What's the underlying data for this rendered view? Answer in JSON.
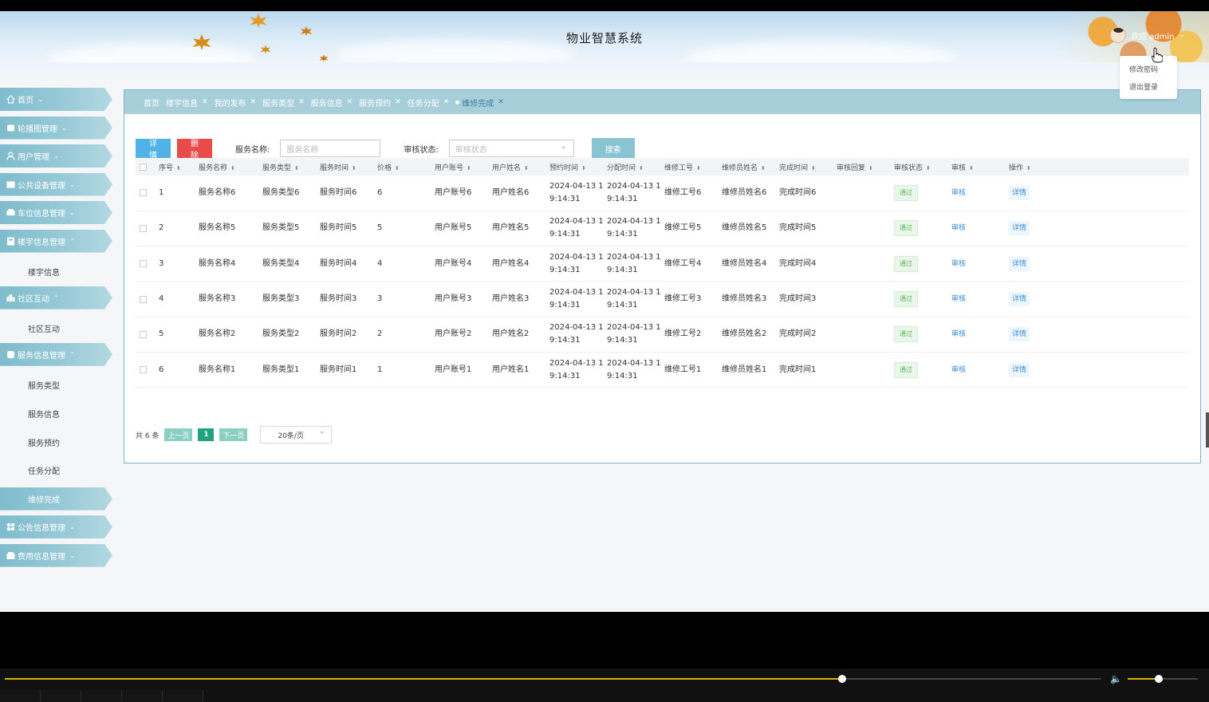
{
  "header": {
    "title": "物业智慧系统",
    "welcome": "欢迎 admin"
  },
  "user_menu": {
    "items": [
      "修改密码",
      "退出登录"
    ]
  },
  "sidebar": {
    "menus": [
      {
        "label": "首页",
        "icon": "home-icon",
        "expanded": false,
        "children": []
      },
      {
        "label": "轮播图管理",
        "icon": "image-icon",
        "expanded": false,
        "children": []
      },
      {
        "label": "用户管理",
        "icon": "user-icon",
        "expanded": false,
        "children": []
      },
      {
        "label": "公共设备管理",
        "icon": "device-icon",
        "expanded": false,
        "children": []
      },
      {
        "label": "车位信息管理",
        "icon": "car-icon",
        "expanded": false,
        "children": []
      },
      {
        "label": "楼宇信息管理",
        "icon": "building-icon",
        "expanded": true,
        "children": [
          "楼宇信息"
        ]
      },
      {
        "label": "社区互动",
        "icon": "community-icon",
        "expanded": true,
        "children": [
          "社区互动"
        ]
      },
      {
        "label": "服务信息管理",
        "icon": "service-icon",
        "expanded": true,
        "children": [
          "服务类型",
          "服务信息",
          "服务预约",
          "任务分配",
          "维修完成"
        ]
      },
      {
        "label": "公告信息管理",
        "icon": "notice-icon",
        "expanded": false,
        "children": []
      },
      {
        "label": "费用信息管理",
        "icon": "fee-icon",
        "expanded": false,
        "children": []
      }
    ],
    "active_child": "维修完成"
  },
  "tabs": [
    {
      "label": "首页",
      "closable": false,
      "active": false
    },
    {
      "label": "楼宇信息",
      "closable": true,
      "active": false
    },
    {
      "label": "我的发布",
      "closable": true,
      "active": false
    },
    {
      "label": "服务类型",
      "closable": true,
      "active": false
    },
    {
      "label": "服务信息",
      "closable": true,
      "active": false
    },
    {
      "label": "服务预约",
      "closable": true,
      "active": false
    },
    {
      "label": "任务分配",
      "closable": true,
      "active": false
    },
    {
      "label": "维修完成",
      "closable": true,
      "active": true
    }
  ],
  "toolbar": {
    "detail_label": "详情",
    "delete_label": "删除",
    "service_name_label": "服务名称:",
    "service_name_placeholder": "服务名称",
    "audit_status_label": "审核状态:",
    "audit_status_placeholder": "审核状态",
    "search_label": "搜索"
  },
  "table": {
    "columns": [
      "序号",
      "服务名称",
      "服务类型",
      "服务时间",
      "价格",
      "用户账号",
      "用户姓名",
      "预约时间",
      "分配时间",
      "维修工号",
      "维修员姓名",
      "完成时间",
      "审核回复",
      "审核状态",
      "审核",
      "操作"
    ],
    "rows": [
      {
        "no": "1",
        "name": "服务名称6",
        "type": "服务类型6",
        "time": "服务时间6",
        "price": "6",
        "account": "用户账号6",
        "username": "用户姓名6",
        "appt1": "2024-04-13 1",
        "appt2": "9:14:31",
        "assign1": "2024-04-13 1",
        "assign2": "9:14:31",
        "worker_id": "维修工号6",
        "worker_name": "维修员姓名6",
        "done": "完成时间6",
        "reply": "",
        "status": "通过",
        "audit": "审核",
        "op": "详情"
      },
      {
        "no": "2",
        "name": "服务名称5",
        "type": "服务类型5",
        "time": "服务时间5",
        "price": "5",
        "account": "用户账号5",
        "username": "用户姓名5",
        "appt1": "2024-04-13 1",
        "appt2": "9:14:31",
        "assign1": "2024-04-13 1",
        "assign2": "9:14:31",
        "worker_id": "维修工号5",
        "worker_name": "维修员姓名5",
        "done": "完成时间5",
        "reply": "",
        "status": "通过",
        "audit": "审核",
        "op": "详情"
      },
      {
        "no": "3",
        "name": "服务名称4",
        "type": "服务类型4",
        "time": "服务时间4",
        "price": "4",
        "account": "用户账号4",
        "username": "用户姓名4",
        "appt1": "2024-04-13 1",
        "appt2": "9:14:31",
        "assign1": "2024-04-13 1",
        "assign2": "9:14:31",
        "worker_id": "维修工号4",
        "worker_name": "维修员姓名4",
        "done": "完成时间4",
        "reply": "",
        "status": "通过",
        "audit": "审核",
        "op": "详情"
      },
      {
        "no": "4",
        "name": "服务名称3",
        "type": "服务类型3",
        "time": "服务时间3",
        "price": "3",
        "account": "用户账号3",
        "username": "用户姓名3",
        "appt1": "2024-04-13 1",
        "appt2": "9:14:31",
        "assign1": "2024-04-13 1",
        "assign2": "9:14:31",
        "worker_id": "维修工号3",
        "worker_name": "维修员姓名3",
        "done": "完成时间3",
        "reply": "",
        "status": "通过",
        "audit": "审核",
        "op": "详情"
      },
      {
        "no": "5",
        "name": "服务名称2",
        "type": "服务类型2",
        "time": "服务时间2",
        "price": "2",
        "account": "用户账号2",
        "username": "用户姓名2",
        "appt1": "2024-04-13 1",
        "appt2": "9:14:31",
        "assign1": "2024-04-13 1",
        "assign2": "9:14:31",
        "worker_id": "维修工号2",
        "worker_name": "维修员姓名2",
        "done": "完成时间2",
        "reply": "",
        "status": "通过",
        "audit": "审核",
        "op": "详情"
      },
      {
        "no": "6",
        "name": "服务名称1",
        "type": "服务类型1",
        "time": "服务时间1",
        "price": "1",
        "account": "用户账号1",
        "username": "用户姓名1",
        "appt1": "2024-04-13 1",
        "appt2": "9:14:31",
        "assign1": "2024-04-13 1",
        "assign2": "9:14:31",
        "worker_id": "维修工号1",
        "worker_name": "维修员姓名1",
        "done": "完成时间1",
        "reply": "",
        "status": "通过",
        "audit": "审核",
        "op": "详情"
      }
    ]
  },
  "pager": {
    "total": "共 6 条",
    "prev": "上一页",
    "page": "1",
    "next": "下一页",
    "page_size": "20条/页"
  },
  "player": {
    "progress": 0.764,
    "volume": 0.44
  },
  "colors": {
    "accent": "#8bc3d2",
    "danger": "#e94a4a",
    "primary": "#4fb3e8",
    "pager_active": "#1fa37e",
    "progress": "#d7b400"
  }
}
